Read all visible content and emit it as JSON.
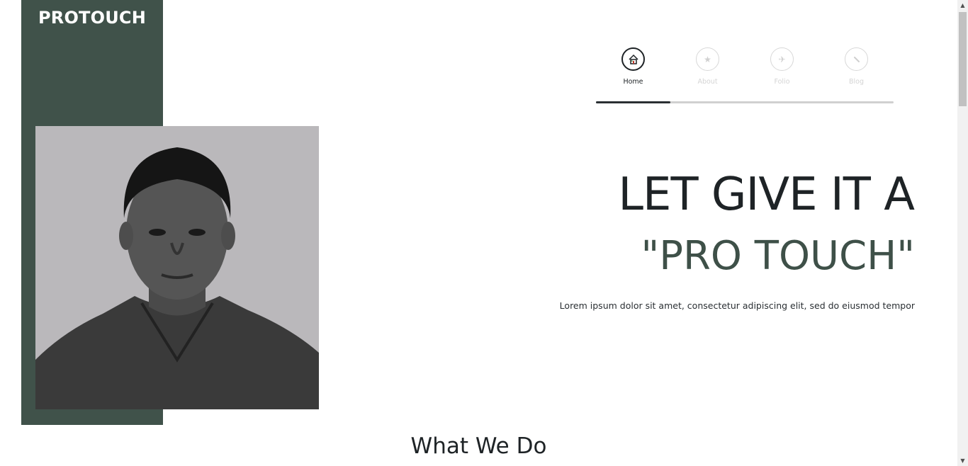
{
  "brand": {
    "name": "PROTOUCH"
  },
  "nav": {
    "items": [
      {
        "label": "Home",
        "icon": "home-icon",
        "active": true
      },
      {
        "label": "About",
        "icon": "star-icon",
        "active": false
      },
      {
        "label": "Folio",
        "icon": "plane-icon",
        "active": false
      },
      {
        "label": "Blog",
        "icon": "pencil-icon",
        "active": false
      }
    ],
    "progress_fraction": 0.25
  },
  "hero": {
    "line1": "LET GIVE IT A",
    "line2": "\"PRO TOUCH\"",
    "text": "Lorem ipsum dolor sit amet, consectetur adipiscing elit, sed do eiusmod tempor"
  },
  "section": {
    "title": "What We Do"
  },
  "colors": {
    "accent": "#40524a",
    "heading": "#1e2326",
    "accent_text": "#3e5048",
    "inactive": "#d0d0d0"
  }
}
